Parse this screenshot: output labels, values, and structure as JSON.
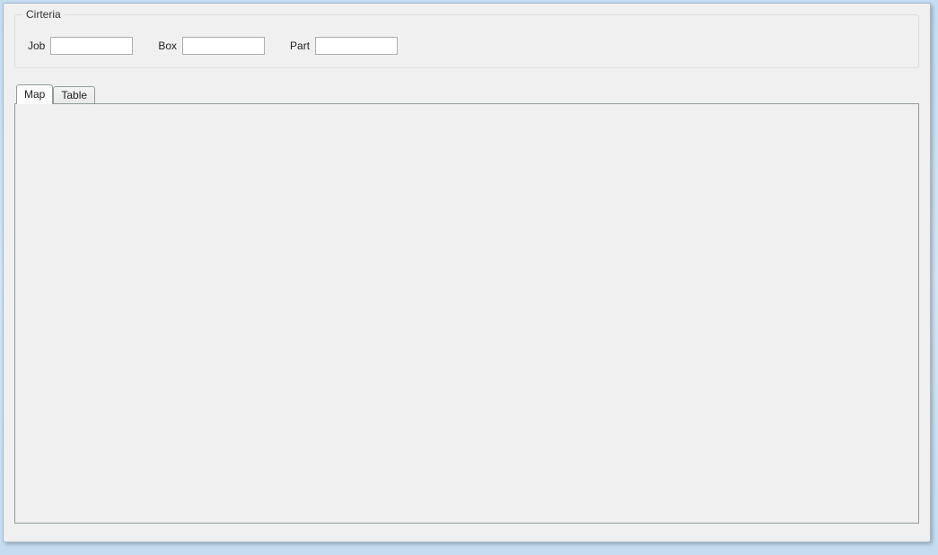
{
  "criteria": {
    "groupTitle": "Cirteria",
    "jobLabel": "Job",
    "jobValue": "",
    "boxLabel": "Box",
    "boxValue": "",
    "partLabel": "Part",
    "partValue": ""
  },
  "tabs": {
    "map": "Map",
    "table": "Table",
    "active": "map"
  }
}
